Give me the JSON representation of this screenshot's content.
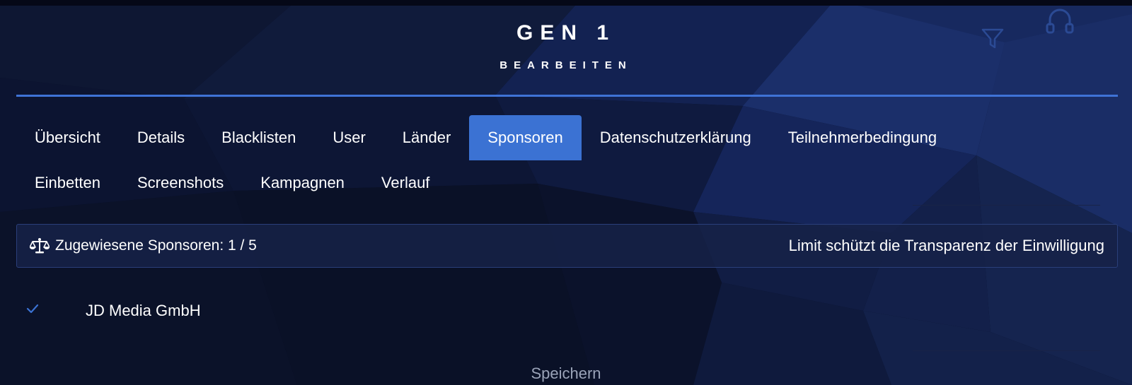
{
  "header": {
    "title": "GEN 1",
    "subtitle": "BEARBEITEN",
    "icons": [
      "filter-icon",
      "headset-icon"
    ]
  },
  "tabs": {
    "row1": [
      {
        "label": "Übersicht",
        "active": false
      },
      {
        "label": "Details",
        "active": false
      },
      {
        "label": "Blacklisten",
        "active": false
      },
      {
        "label": "User",
        "active": false
      },
      {
        "label": "Länder",
        "active": false
      },
      {
        "label": "Sponsoren",
        "active": true
      },
      {
        "label": "Datenschutzerklärung",
        "active": false
      },
      {
        "label": "Teilnehmerbedingung",
        "active": false
      }
    ],
    "row2": [
      {
        "label": "Einbetten",
        "active": false
      },
      {
        "label": "Screenshots",
        "active": false
      },
      {
        "label": "Kampagnen",
        "active": false
      },
      {
        "label": "Verlauf",
        "active": false
      }
    ]
  },
  "info_bar": {
    "icon": "balance-scale-icon",
    "assigned_text": "Zugewiesene Sponsoren: 1 / 5",
    "limit_text": "Limit schützt die Transparenz der Einwilligung"
  },
  "sponsors": [
    {
      "name": "JD Media GmbH",
      "selected": true,
      "icon": "check-icon"
    }
  ],
  "actions": {
    "save_label": "Speichern"
  },
  "colors": {
    "background": "#0b1128",
    "accent": "#3b72d3",
    "divider": "#3f73d6",
    "info_bar_border": "#2a3f7a",
    "muted_text": "#9aa3b8"
  }
}
